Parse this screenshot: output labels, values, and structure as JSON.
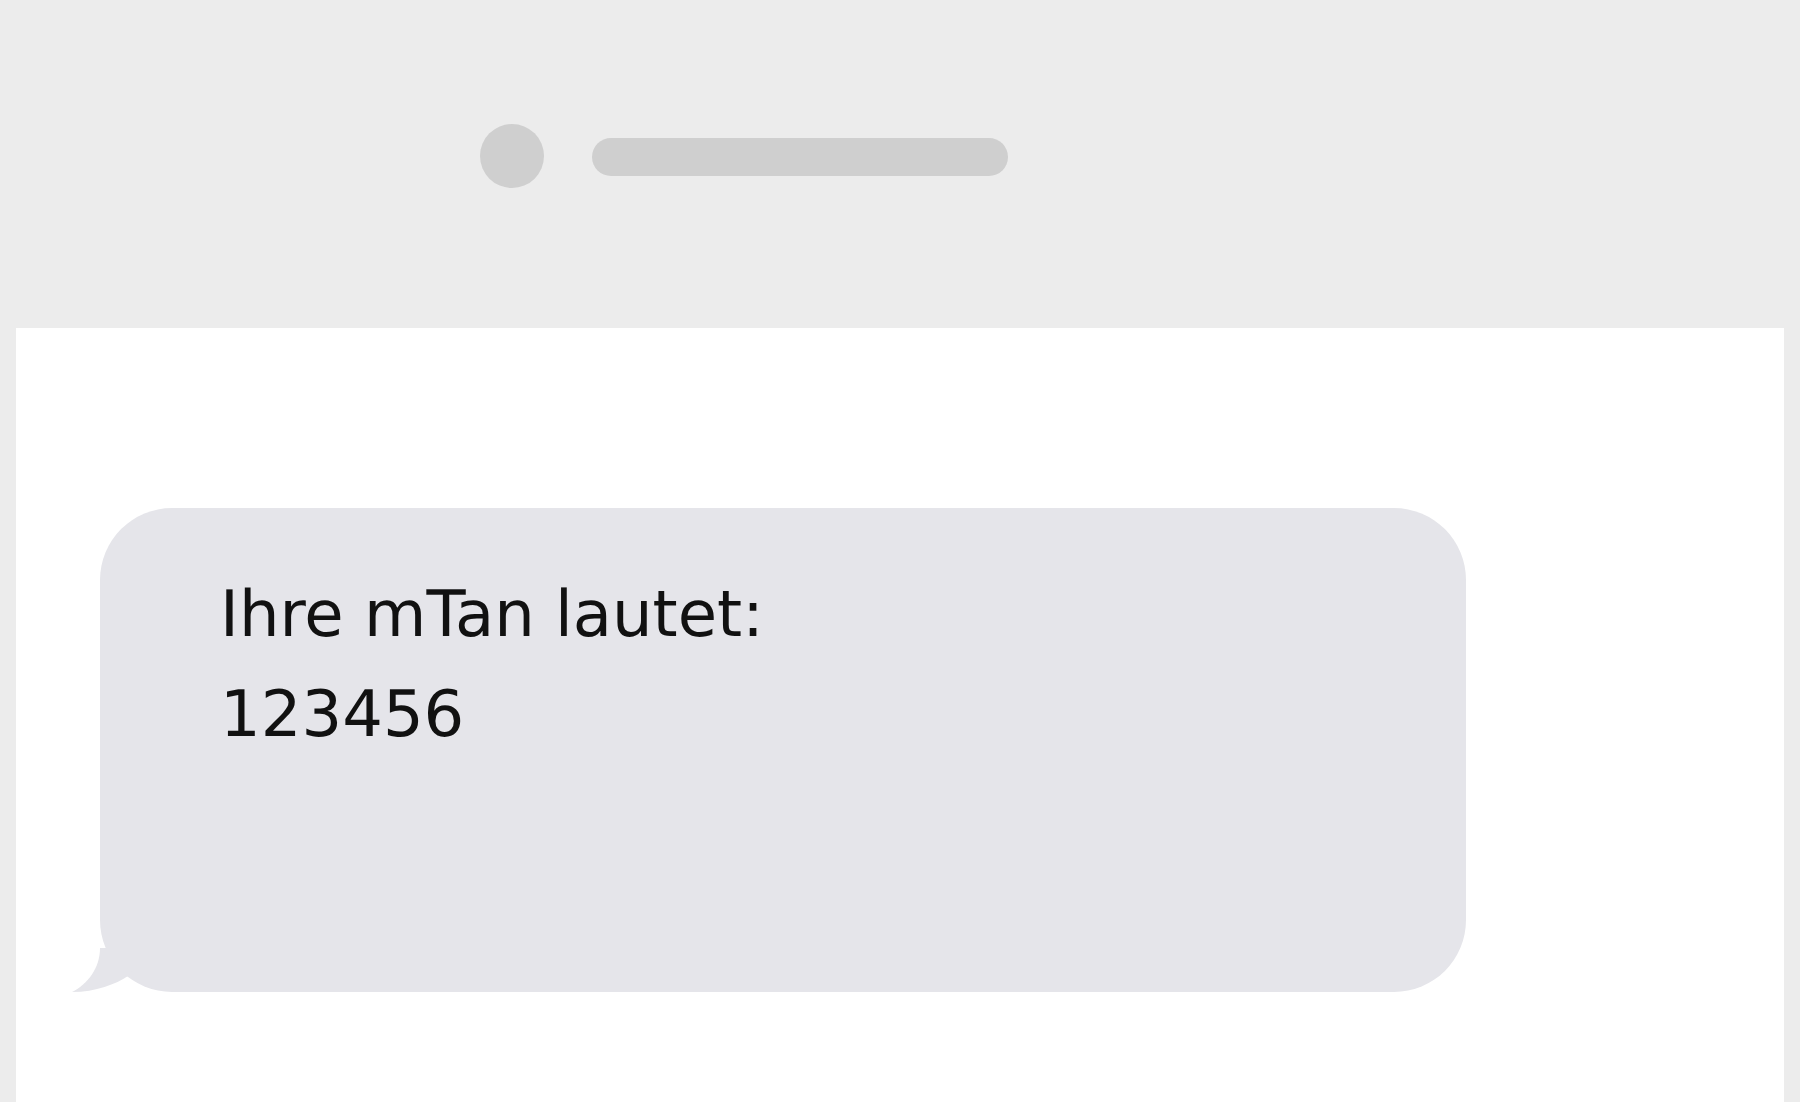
{
  "message": {
    "text": "Ihre mTan lautet:\n123456"
  }
}
